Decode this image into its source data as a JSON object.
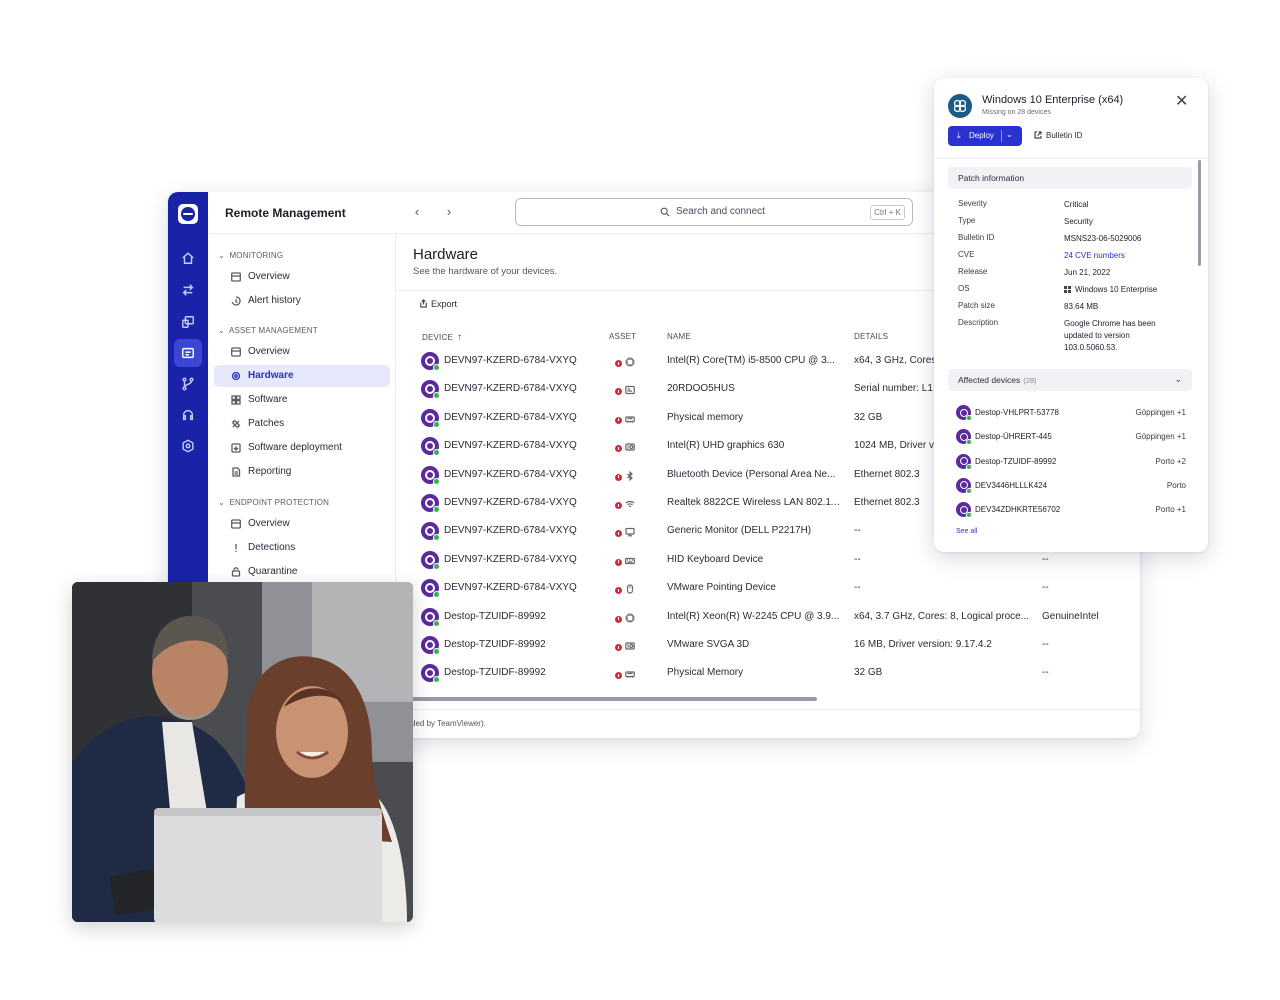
{
  "app": {
    "title": "Remote Management",
    "search": {
      "placeholder": "Search and connect",
      "shortcut": "Ctrl + K"
    }
  },
  "rail": {
    "icons": [
      "home-icon",
      "transfer-icon",
      "devices-icon",
      "hardware-icon",
      "branch-icon",
      "headset-icon",
      "shield-settings-icon"
    ]
  },
  "sidebar": {
    "sections": [
      {
        "label": "MONITORING",
        "items": [
          "Overview",
          "Alert history"
        ]
      },
      {
        "label": "ASSET MANAGEMENT",
        "items": [
          "Overview",
          "Hardware",
          "Software",
          "Patches",
          "Software deployment",
          "Reporting"
        ]
      },
      {
        "label": "ENDPOINT PROTECTION",
        "items": [
          "Overview",
          "Detections",
          "Quarantine"
        ]
      }
    ],
    "active": "Hardware"
  },
  "page": {
    "title": "Hardware",
    "subtitle": "See the hardware of your devices.",
    "export_label": "Export",
    "footer_text": "ded by TeamViewer)."
  },
  "table": {
    "headers": [
      "DEVICE",
      "ASSET",
      "NAME",
      "DETAILS"
    ],
    "rows": [
      {
        "device": "DEVN97-KZERD-6784-VXYQ",
        "asset": "cpu-icon",
        "name": "Intel(R) Core(TM) i5-8500 CPU @ 3...",
        "details": "x64, 3 GHz, Cores",
        "extra": ""
      },
      {
        "device": "DEVN97-KZERD-6784-VXYQ",
        "asset": "board-icon",
        "name": "20RDOO5HUS",
        "details": "Serial number: L1",
        "extra": ""
      },
      {
        "device": "DEVN97-KZERD-6784-VXYQ",
        "asset": "memory-icon",
        "name": "Physical memory",
        "details": "32 GB",
        "extra": ""
      },
      {
        "device": "DEVN97-KZERD-6784-VXYQ",
        "asset": "gpu-icon",
        "name": "Intel(R) UHD graphics 630",
        "details": "1024 MB, Driver v",
        "extra": ""
      },
      {
        "device": "DEVN97-KZERD-6784-VXYQ",
        "asset": "bluetooth-icon",
        "name": "Bluetooth Device (Personal Area Ne...",
        "details": "Ethernet 802.3",
        "extra": ""
      },
      {
        "device": "DEVN97-KZERD-6784-VXYQ",
        "asset": "wifi-icon",
        "name": "Realtek 8822CE Wireless LAN 802.11...",
        "details": "Ethernet 802.3",
        "extra": ""
      },
      {
        "device": "DEVN97-KZERD-6784-VXYQ",
        "asset": "monitor-icon",
        "name": "Generic Monitor (DELL P2217H)",
        "details": "--",
        "extra": ""
      },
      {
        "device": "DEVN97-KZERD-6784-VXYQ",
        "asset": "keyboard-icon",
        "name": "HID Keyboard Device",
        "details": "--",
        "extra": "--"
      },
      {
        "device": "DEVN97-KZERD-6784-VXYQ",
        "asset": "mouse-icon",
        "name": "VMware Pointing Device",
        "details": "--",
        "extra": "--"
      },
      {
        "device": "Destop-TZUIDF-89992",
        "asset": "cpu-icon",
        "name": "Intel(R) Xeon(R) W-2245 CPU @ 3.9...",
        "details": "x64, 3.7 GHz, Cores: 8, Logical proce...",
        "extra": "GenuineIntel"
      },
      {
        "device": "Destop-TZUIDF-89992",
        "asset": "gpu-icon",
        "name": "VMware SVGA 3D",
        "details": "16 MB, Driver version: 9.17.4.2",
        "extra": "--"
      },
      {
        "device": "Destop-TZUIDF-89992",
        "asset": "memory-icon",
        "name": "Physical Memory",
        "details": "32 GB",
        "extra": "--"
      }
    ]
  },
  "panel": {
    "title": "Windows 10 Enterprise (x64)",
    "subtitle": "Missing on 28 devices",
    "deploy_label": "Deploy",
    "bulletin_label": "Bulletin ID",
    "patch_section": "Patch information",
    "fields": [
      {
        "key": "Severity",
        "value": "Critical"
      },
      {
        "key": "Type",
        "value": "Security"
      },
      {
        "key": "Bulletin ID",
        "value": "MSNS23-06-5029006"
      },
      {
        "key": "CVE",
        "value": "24 CVE numbers"
      },
      {
        "key": "Release",
        "value": "Jun 21, 2022"
      },
      {
        "key": "OS",
        "value": "Windows 10 Enterprise"
      },
      {
        "key": "Patch size",
        "value": "83.64 MB"
      },
      {
        "key": "Description",
        "value": "Google Chrome has been updated to version 103.0.5060.53."
      }
    ],
    "affected_label": "Affected devices",
    "affected_count": "(28)",
    "affected": [
      {
        "name": "Destop-VHLPRT-53778",
        "location": "Göppingen +1"
      },
      {
        "name": "Destop-ÜHRERT-445",
        "location": "Göppingen +1"
      },
      {
        "name": "Destop-TZUIDF-89992",
        "location": "Porto +2"
      },
      {
        "name": "DEV3446HLLLK424",
        "location": "Porto"
      },
      {
        "name": "DEV34ZDHKRTE56702",
        "location": "Porto +1"
      }
    ],
    "see_all": "See all"
  },
  "colors": {
    "accent": "#2a32d0",
    "rail": "#1a22a8",
    "device_icon": "#5b2a9e",
    "online": "#36b34a",
    "alert": "#d6283a"
  }
}
